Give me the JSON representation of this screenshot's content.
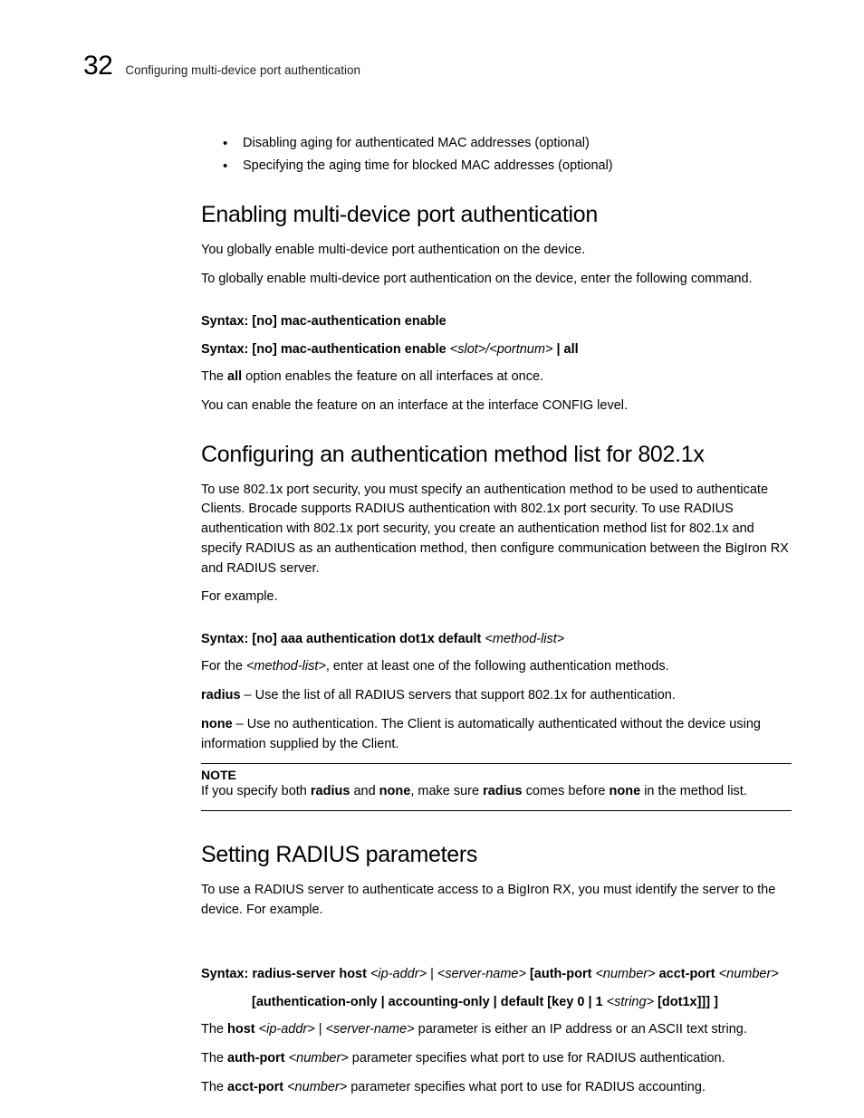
{
  "header": {
    "page_number": "32",
    "title": "Configuring multi-device port authentication"
  },
  "bullets": [
    "Disabling aging for authenticated MAC addresses (optional)",
    "Specifying the aging time for blocked MAC addresses (optional)"
  ],
  "sections": {
    "enabling": {
      "heading": "Enabling multi-device port authentication",
      "p1": "You globally enable multi-device port authentication on the device.",
      "p2": "To globally enable multi-device port authentication on the device, enter the following command.",
      "syntax1_label": "Syntax:",
      "syntax1_body": " [no] mac-authentication enable",
      "syntax2_label": "Syntax:",
      "syntax2_body": " [no] mac-authentication enable ",
      "syntax2_var": "<slot>/<portnum>",
      "syntax2_tail": " | all",
      "p3a": "The ",
      "p3b": "all",
      "p3c": " option enables the feature on all interfaces at once.",
      "p4": "You can enable the feature on an interface at the interface CONFIG level."
    },
    "configuring": {
      "heading": "Configuring an authentication method list for 802.1x",
      "p1": "To use 802.1x port security, you must specify an authentication method to be used to authenticate Clients. Brocade supports RADIUS authentication with 802.1x port security. To use RADIUS authentication with 802.1x port security, you create an authentication method list for 802.1x and specify RADIUS as an authentication method, then configure communication between the BigIron RX and RADIUS server.",
      "p2": "For example.",
      "syntax1_label": "Syntax:",
      "syntax1_body": " [no] aaa authentication dot1x default ",
      "syntax1_var": "<method-list>",
      "p3a": "For the ",
      "p3b": "<method-list>",
      "p3c": ", enter at least one of the following authentication methods.",
      "p4a": "radius",
      "p4b": " – Use the list of all RADIUS servers that support 802.1x for authentication.",
      "p5a": "none",
      "p5b": " – Use no authentication. The Client is automatically authenticated without the device using information supplied by the Client.",
      "note_label": "NOTE",
      "note_a": "If you specify both ",
      "note_b": "radius",
      "note_c": " and ",
      "note_d": "none",
      "note_e": ", make sure ",
      "note_f": "radius",
      "note_g": " comes before ",
      "note_h": "none",
      "note_i": " in the method list."
    },
    "radius": {
      "heading": "Setting RADIUS parameters",
      "p1": "To use a RADIUS server to authenticate access to a BigIron RX, you must identify the server to the device. For example.",
      "syn_label": "Syntax:",
      "syn_l1a": " radius-server host ",
      "syn_l1b": "<ip-addr>",
      "syn_l1c": " | ",
      "syn_l1d": "<server-name>",
      "syn_l1e": " [auth-port ",
      "syn_l1f": "<number>",
      "syn_l1g": " acct-port ",
      "syn_l1h": "<number>",
      "syn_l2a": "[authentication-only | accounting-only | default [key 0 | 1 ",
      "syn_l2b": "<string>",
      "syn_l2c": " [dot1x]]] ]",
      "p2a": "The ",
      "p2b": "host",
      "p2c": " ",
      "p2d": "<ip-addr>",
      "p2e": " | ",
      "p2f": "<server-name>",
      "p2g": " parameter is either an IP address or an ASCII text string.",
      "p3a": "The ",
      "p3b": "auth-port",
      "p3c": " ",
      "p3d": "<number>",
      "p3e": " parameter specifies what port to use for RADIUS authentication.",
      "p4a": "The ",
      "p4b": "acct-port",
      "p4c": " ",
      "p4d": "<number>",
      "p4e": " parameter specifies what port to use for RADIUS accounting."
    }
  }
}
